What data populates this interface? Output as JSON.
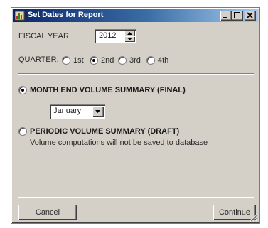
{
  "window": {
    "title": "Set Dates for Report",
    "title_bar_colors": [
      "#0a246a",
      "#a6caf0"
    ],
    "face_color": "#d4d0c8"
  },
  "fiscal_year": {
    "label": "FISCAL YEAR",
    "value": "2012"
  },
  "quarter": {
    "label": "QUARTER:",
    "options": [
      {
        "label": "1st",
        "selected": false
      },
      {
        "label": "2nd",
        "selected": true
      },
      {
        "label": "3rd",
        "selected": false
      },
      {
        "label": "4th",
        "selected": false
      }
    ]
  },
  "report_type": {
    "month_end": {
      "label": "MONTH END VOLUME SUMMARY (FINAL)",
      "selected": true,
      "month_value": "January"
    },
    "periodic": {
      "label": "PERIODIC VOLUME SUMMARY (DRAFT)",
      "selected": false,
      "note": "Volume computations will not be saved to database"
    }
  },
  "buttons": {
    "cancel": "Cancel",
    "continue": "Continue"
  },
  "icons": {
    "app": "report-app-icon",
    "minimize": "minimize-icon",
    "maximize": "maximize-icon",
    "close": "close-icon",
    "spin_up": "chevron-up-icon",
    "spin_down": "chevron-down-icon",
    "dropdown": "chevron-down-icon",
    "resize": "resize-grip-icon"
  }
}
